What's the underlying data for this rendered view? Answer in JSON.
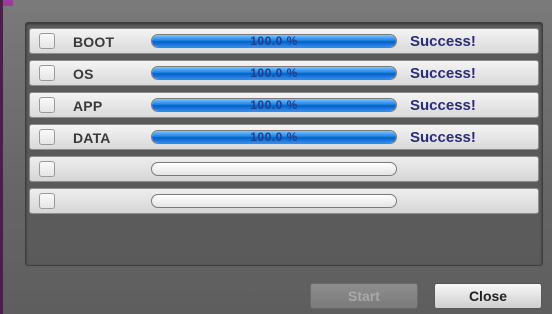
{
  "rows": [
    {
      "label": "BOOT",
      "progress_text": "100.0 %",
      "progress": 1.0,
      "status": "Success!"
    },
    {
      "label": "OS",
      "progress_text": "100.0 %",
      "progress": 1.0,
      "status": "Success!"
    },
    {
      "label": "APP",
      "progress_text": "100.0 %",
      "progress": 1.0,
      "status": "Success!"
    },
    {
      "label": "DATA",
      "progress_text": "100.0 %",
      "progress": 1.0,
      "status": "Success!"
    },
    {
      "label": "",
      "progress_text": "",
      "progress": 0,
      "status": ""
    },
    {
      "label": "",
      "progress_text": "",
      "progress": 0,
      "status": ""
    }
  ],
  "buttons": {
    "start_label": "Start",
    "start_enabled": false,
    "close_label": "Close"
  },
  "colors": {
    "progress_fill": "#1c86e8",
    "status_text": "#2b2b7a",
    "window_bg": "#6e6e6e"
  }
}
